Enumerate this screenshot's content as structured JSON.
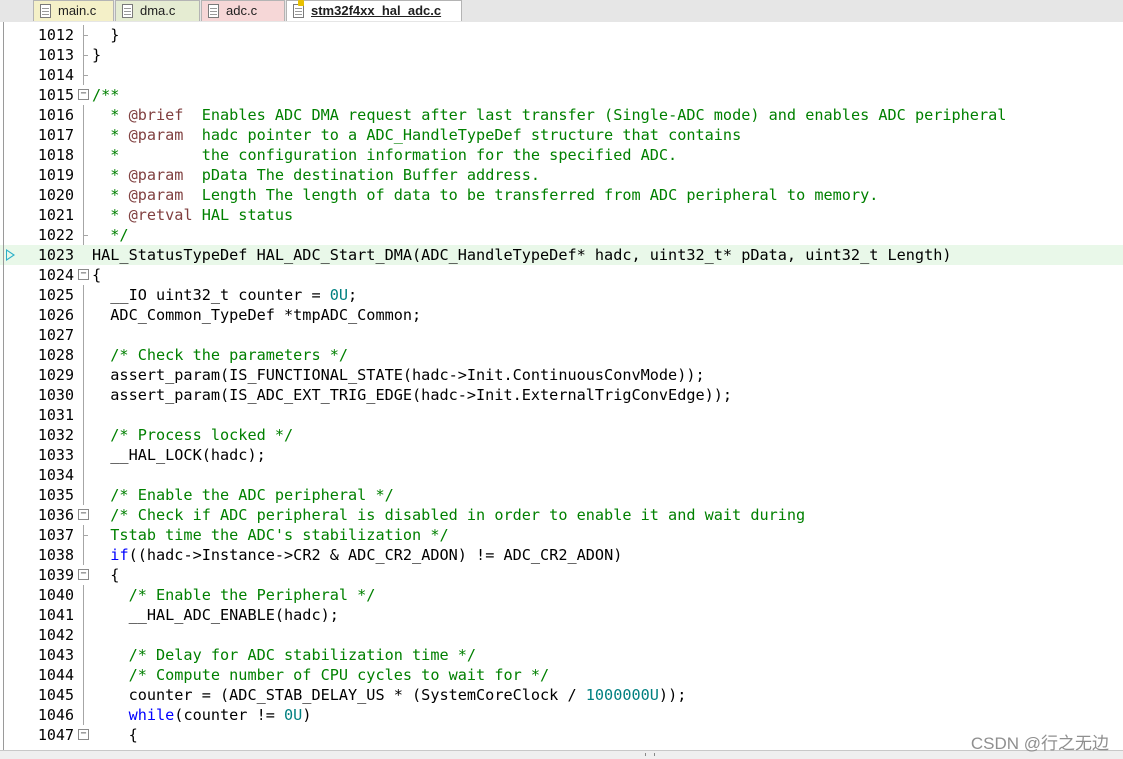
{
  "tabs": [
    {
      "label": "main.c",
      "bg": "#f4f0c8",
      "active": false
    },
    {
      "label": "dma.c",
      "bg": "#e5ecd2",
      "active": false
    },
    {
      "label": "adc.c",
      "bg": "#f6d7d7",
      "active": false
    },
    {
      "label": "stm32f4xx_hal_adc.c",
      "bg": "#ffffff",
      "active": true
    }
  ],
  "watermark": "CSDN @行之无边",
  "colors": {
    "comment": "#008000",
    "keyword": "#0000ff",
    "number": "#008080",
    "doc_tag": "#804040",
    "default": "#000000",
    "current_line": "#e9f8e9"
  },
  "current_line": "1023",
  "lines": [
    {
      "n": "1012",
      "g": "tick",
      "c": [
        [
          "d",
          "  }"
        ]
      ]
    },
    {
      "n": "1013",
      "g": "tick",
      "c": [
        [
          "d",
          "}"
        ]
      ]
    },
    {
      "n": "1014",
      "g": "tick",
      "c": []
    },
    {
      "n": "1015",
      "g": "box",
      "c": [
        [
          "c",
          "/**"
        ]
      ]
    },
    {
      "n": "1016",
      "g": "line",
      "c": [
        [
          "c",
          "  * "
        ],
        [
          "t",
          "@brief"
        ],
        [
          "c",
          "  Enables ADC DMA request after last transfer (Single-ADC mode) and enables ADC peripheral"
        ]
      ]
    },
    {
      "n": "1017",
      "g": "line",
      "c": [
        [
          "c",
          "  * "
        ],
        [
          "t",
          "@param"
        ],
        [
          "c",
          "  hadc pointer to a ADC_HandleTypeDef structure that contains"
        ]
      ]
    },
    {
      "n": "1018",
      "g": "line",
      "c": [
        [
          "c",
          "  *         the configuration information for the specified ADC."
        ]
      ]
    },
    {
      "n": "1019",
      "g": "line",
      "c": [
        [
          "c",
          "  * "
        ],
        [
          "t",
          "@param"
        ],
        [
          "c",
          "  pData The destination Buffer address."
        ]
      ]
    },
    {
      "n": "1020",
      "g": "line",
      "c": [
        [
          "c",
          "  * "
        ],
        [
          "t",
          "@param"
        ],
        [
          "c",
          "  Length The length of data to be transferred from ADC peripheral to memory."
        ]
      ]
    },
    {
      "n": "1021",
      "g": "line",
      "c": [
        [
          "c",
          "  * "
        ],
        [
          "t",
          "@retval"
        ],
        [
          "c",
          " HAL status"
        ]
      ]
    },
    {
      "n": "1022",
      "g": "tick",
      "c": [
        [
          "c",
          "  */"
        ]
      ]
    },
    {
      "n": "1023",
      "g": "none",
      "c": [
        [
          "d",
          "HAL_StatusTypeDef HAL_ADC_Start_DMA(ADC_HandleTypeDef* hadc, uint32_t* pData, uint32_t Length)"
        ]
      ]
    },
    {
      "n": "1024",
      "g": "box",
      "c": [
        [
          "d",
          "{"
        ]
      ]
    },
    {
      "n": "1025",
      "g": "line",
      "c": [
        [
          "d",
          "  __IO uint32_t counter = "
        ],
        [
          "n",
          "0U"
        ],
        [
          "d",
          ";"
        ]
      ]
    },
    {
      "n": "1026",
      "g": "line",
      "c": [
        [
          "d",
          "  ADC_Common_TypeDef *tmpADC_Common;"
        ]
      ]
    },
    {
      "n": "1027",
      "g": "line",
      "c": []
    },
    {
      "n": "1028",
      "g": "line",
      "c": [
        [
          "c",
          "  /* Check the parameters */"
        ]
      ]
    },
    {
      "n": "1029",
      "g": "line",
      "c": [
        [
          "d",
          "  assert_param(IS_FUNCTIONAL_STATE(hadc->Init.ContinuousConvMode));"
        ]
      ]
    },
    {
      "n": "1030",
      "g": "line",
      "c": [
        [
          "d",
          "  assert_param(IS_ADC_EXT_TRIG_EDGE(hadc->Init.ExternalTrigConvEdge));"
        ]
      ]
    },
    {
      "n": "1031",
      "g": "line",
      "c": []
    },
    {
      "n": "1032",
      "g": "line",
      "c": [
        [
          "c",
          "  /* Process locked */"
        ]
      ]
    },
    {
      "n": "1033",
      "g": "line",
      "c": [
        [
          "d",
          "  __HAL_LOCK(hadc);"
        ]
      ]
    },
    {
      "n": "1034",
      "g": "line",
      "c": []
    },
    {
      "n": "1035",
      "g": "line",
      "c": [
        [
          "c",
          "  /* Enable the ADC peripheral */"
        ]
      ]
    },
    {
      "n": "1036",
      "g": "box",
      "c": [
        [
          "c",
          "  /* Check if ADC peripheral is disabled in order to enable it and wait during"
        ]
      ]
    },
    {
      "n": "1037",
      "g": "tick",
      "c": [
        [
          "c",
          "  Tstab time the ADC's stabilization */"
        ]
      ]
    },
    {
      "n": "1038",
      "g": "line",
      "c": [
        [
          "d",
          "  "
        ],
        [
          "k",
          "if"
        ],
        [
          "d",
          "((hadc->Instance->CR2 & ADC_CR2_ADON) != ADC_CR2_ADON)"
        ]
      ]
    },
    {
      "n": "1039",
      "g": "box",
      "c": [
        [
          "d",
          "  {"
        ]
      ]
    },
    {
      "n": "1040",
      "g": "line",
      "c": [
        [
          "c",
          "    /* Enable the Peripheral */"
        ]
      ]
    },
    {
      "n": "1041",
      "g": "line",
      "c": [
        [
          "d",
          "    __HAL_ADC_ENABLE(hadc);"
        ]
      ]
    },
    {
      "n": "1042",
      "g": "line",
      "c": []
    },
    {
      "n": "1043",
      "g": "line",
      "c": [
        [
          "c",
          "    /* Delay for ADC stabilization time */"
        ]
      ]
    },
    {
      "n": "1044",
      "g": "line",
      "c": [
        [
          "c",
          "    /* Compute number of CPU cycles to wait for */"
        ]
      ]
    },
    {
      "n": "1045",
      "g": "line",
      "c": [
        [
          "d",
          "    counter = (ADC_STAB_DELAY_US * (SystemCoreClock / "
        ],
        [
          "n",
          "1000000U"
        ],
        [
          "d",
          "));"
        ]
      ]
    },
    {
      "n": "1046",
      "g": "line",
      "c": [
        [
          "d",
          "    "
        ],
        [
          "k",
          "while"
        ],
        [
          "d",
          "(counter != "
        ],
        [
          "n",
          "0U"
        ],
        [
          "d",
          ")"
        ]
      ]
    },
    {
      "n": "1047",
      "g": "box",
      "c": [
        [
          "d",
          "    {"
        ]
      ]
    }
  ]
}
